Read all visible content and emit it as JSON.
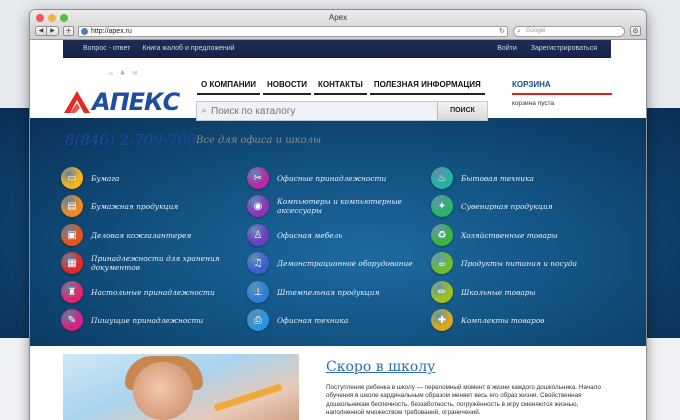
{
  "browser": {
    "title": "Apex",
    "url": "http://apex.ru",
    "search_placeholder": "Google",
    "back": "◀",
    "forward": "▶",
    "add": "+",
    "reload": "↻",
    "gear": "⚙"
  },
  "topnav": {
    "left": [
      "Вопрос - ответ",
      "Книга жалоб и предложений"
    ],
    "login": "Войти",
    "register": "Зарегистрироваться"
  },
  "header": {
    "logo_text": "АПЕКС",
    "menu": [
      "О КОМПАНИИ",
      "НОВОСТИ",
      "КОНТАКТЫ",
      "ПОЛЕЗНАЯ ИНФОРМАЦИЯ"
    ],
    "search_placeholder": "Поиск по каталогу",
    "search_button": "ПОИСК",
    "cart_title": "КОРЗИНА",
    "cart_empty": "корзина пуста",
    "phone": "8(846) 2-709-709",
    "slogan": "Все для офиса и школы",
    "mini_icons": [
      "home-icon",
      "sitemap-icon",
      "mail-icon"
    ]
  },
  "categories": [
    {
      "label": "Бумага",
      "color": "#f3b51e",
      "icon": "paper-icon",
      "glyph": "▭"
    },
    {
      "label": "Бумажная продукция",
      "color": "#f08a1c",
      "icon": "notebook-icon",
      "glyph": "▤"
    },
    {
      "label": "Деловая кожгалантерея",
      "color": "#e8541e",
      "icon": "briefcase-icon",
      "glyph": "▣"
    },
    {
      "label": "Принадлежности для хранения документов",
      "color": "#e02a2a",
      "icon": "folder-icon",
      "glyph": "▦"
    },
    {
      "label": "Настольные принадлежности",
      "color": "#e3266c",
      "icon": "desk-organizer-icon",
      "glyph": "♜"
    },
    {
      "label": "Пишущие принадлежности",
      "color": "#d4237f",
      "icon": "pen-icon",
      "glyph": "✎"
    },
    {
      "label": "Офисные принадлежности",
      "color": "#b52aa6",
      "icon": "scissors-icon",
      "glyph": "✂"
    },
    {
      "label": "Компьютеры и компьютерные аксессуары",
      "color": "#8f33b8",
      "icon": "mouse-icon",
      "glyph": "◉"
    },
    {
      "label": "Офисная мебель",
      "color": "#6d3dc2",
      "icon": "chair-icon",
      "glyph": "♙"
    },
    {
      "label": "Демонстрационное оборудование",
      "color": "#3f5ed0",
      "icon": "microphone-icon",
      "glyph": "♫"
    },
    {
      "label": "Штемпельная продукция",
      "color": "#2f7ed8",
      "icon": "stamp-icon",
      "glyph": "⊥"
    },
    {
      "label": "Офисная техника",
      "color": "#2a95dd",
      "icon": "printer-icon",
      "glyph": "⎙"
    },
    {
      "label": "Бытовая техника",
      "color": "#23b3a2",
      "icon": "kettle-icon",
      "glyph": "♨"
    },
    {
      "label": "Сувенирная продукция",
      "color": "#2bb36a",
      "icon": "gift-icon",
      "glyph": "✦"
    },
    {
      "label": "Хозяйственные товары",
      "color": "#3cb441",
      "icon": "cleaning-icon",
      "glyph": "♻"
    },
    {
      "label": "Продукты питания и посуда",
      "color": "#6cbd2c",
      "icon": "cup-icon",
      "glyph": "☕"
    },
    {
      "label": "Школьные товары",
      "color": "#9fc11f",
      "icon": "school-icon",
      "glyph": "✏"
    },
    {
      "label": "Комплекты товаров",
      "color": "#d8a91c",
      "icon": "kit-icon",
      "glyph": "✚"
    }
  ],
  "promo": {
    "title": "Скоро в школу",
    "text": "Поступление ребенка в школу — переломный момент в жизни каждого дошкольника. Начало обучения в школе кардинальным образом меняет весь его образ жизни. Свойственная дошкольникам беспечность, беззаботность, погружённость в игру сменяются жизнью, наполненной множеством требований, ограничений."
  }
}
